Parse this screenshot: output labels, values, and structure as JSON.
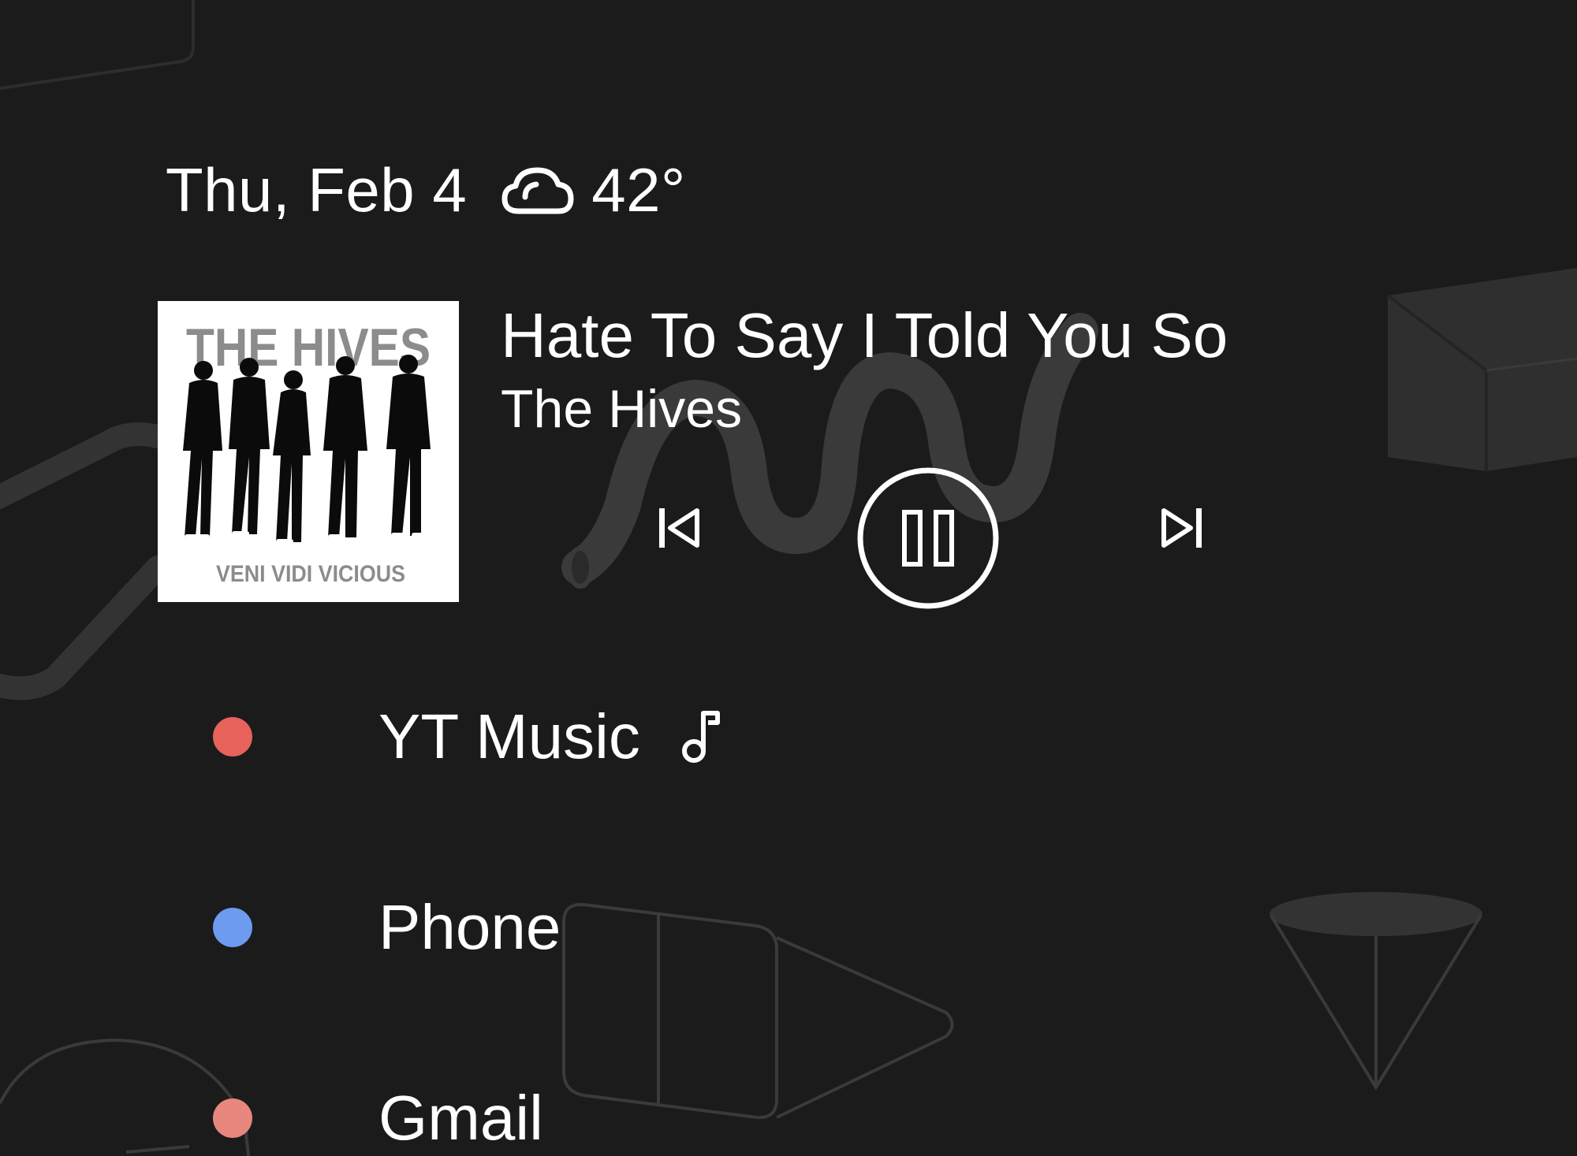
{
  "status": {
    "date": "Thu, Feb 4",
    "weather_icon": "cloud-icon",
    "temperature": "42°"
  },
  "media": {
    "album_art": {
      "band_text": "THE HIVES",
      "album_text": "VENI VIDI VICIOUS"
    },
    "title": "Hate To Say I Told You So",
    "artist": "The Hives",
    "controls": {
      "previous_icon": "skip-previous-icon",
      "play_state_icon": "pause-icon",
      "next_icon": "skip-next-icon"
    }
  },
  "notifications": [
    {
      "label": "YT Music",
      "dot_color": "#e8625c",
      "icon": "music-note-icon"
    },
    {
      "label": "Phone",
      "dot_color": "#6d9bf0"
    },
    {
      "label": "Gmail",
      "dot_color": "#e7877d"
    }
  ],
  "colors": {
    "background": "#1b1b1b",
    "text": "#ffffff"
  }
}
